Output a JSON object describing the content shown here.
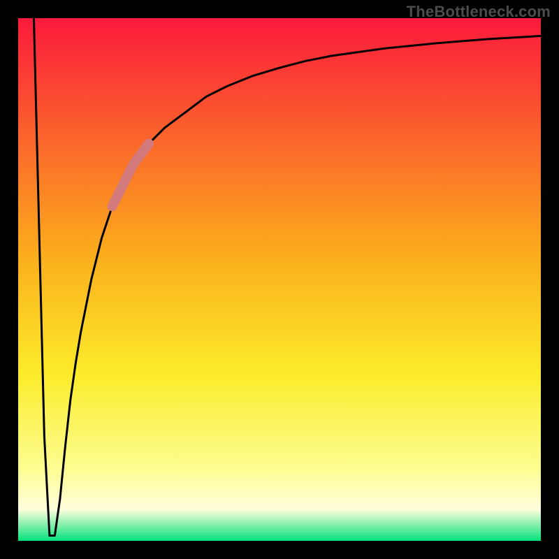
{
  "watermark": "TheBottleneck.com",
  "colors": {
    "background": "#000000",
    "watermark": "#4c4c4c",
    "curve": "#000000",
    "highlight": "#d37a7c",
    "gradient_top": "#fb1a3c",
    "gradient_mid_upper": "#fbac1c",
    "gradient_mid": "#fcec2a",
    "gradient_lower": "#fdfd90",
    "gradient_near_bottom": "#fefedd",
    "gradient_bottom": "#05e17b"
  },
  "chart_data": {
    "type": "line",
    "title": "",
    "xlabel": "",
    "ylabel": "",
    "xlim": [
      0,
      100
    ],
    "ylim": [
      0,
      100
    ],
    "series": [
      {
        "name": "bottleneck-curve",
        "x": [
          3,
          4,
          5,
          6,
          7,
          8,
          9,
          10,
          11,
          12,
          14,
          16,
          18,
          20,
          22,
          25,
          28,
          32,
          36,
          40,
          45,
          50,
          55,
          60,
          70,
          80,
          90,
          100
        ],
        "y": [
          100,
          60,
          20,
          1,
          1,
          8,
          18,
          27,
          34,
          40,
          50,
          58,
          64,
          68,
          72,
          76,
          79,
          82,
          85,
          87,
          89,
          90.5,
          91.8,
          92.8,
          94.2,
          95.2,
          96,
          96.6
        ]
      }
    ],
    "highlight_segment": {
      "series": "bottleneck-curve",
      "x_start": 18,
      "x_end": 25
    },
    "background_gradient": {
      "direction": "vertical",
      "stops": [
        {
          "offset": 0.0,
          "color_key": "gradient_top"
        },
        {
          "offset": 0.45,
          "color_key": "gradient_mid_upper"
        },
        {
          "offset": 0.68,
          "color_key": "gradient_mid"
        },
        {
          "offset": 0.86,
          "color_key": "gradient_lower"
        },
        {
          "offset": 0.94,
          "color_key": "gradient_near_bottom"
        },
        {
          "offset": 1.0,
          "color_key": "gradient_bottom"
        }
      ]
    }
  }
}
